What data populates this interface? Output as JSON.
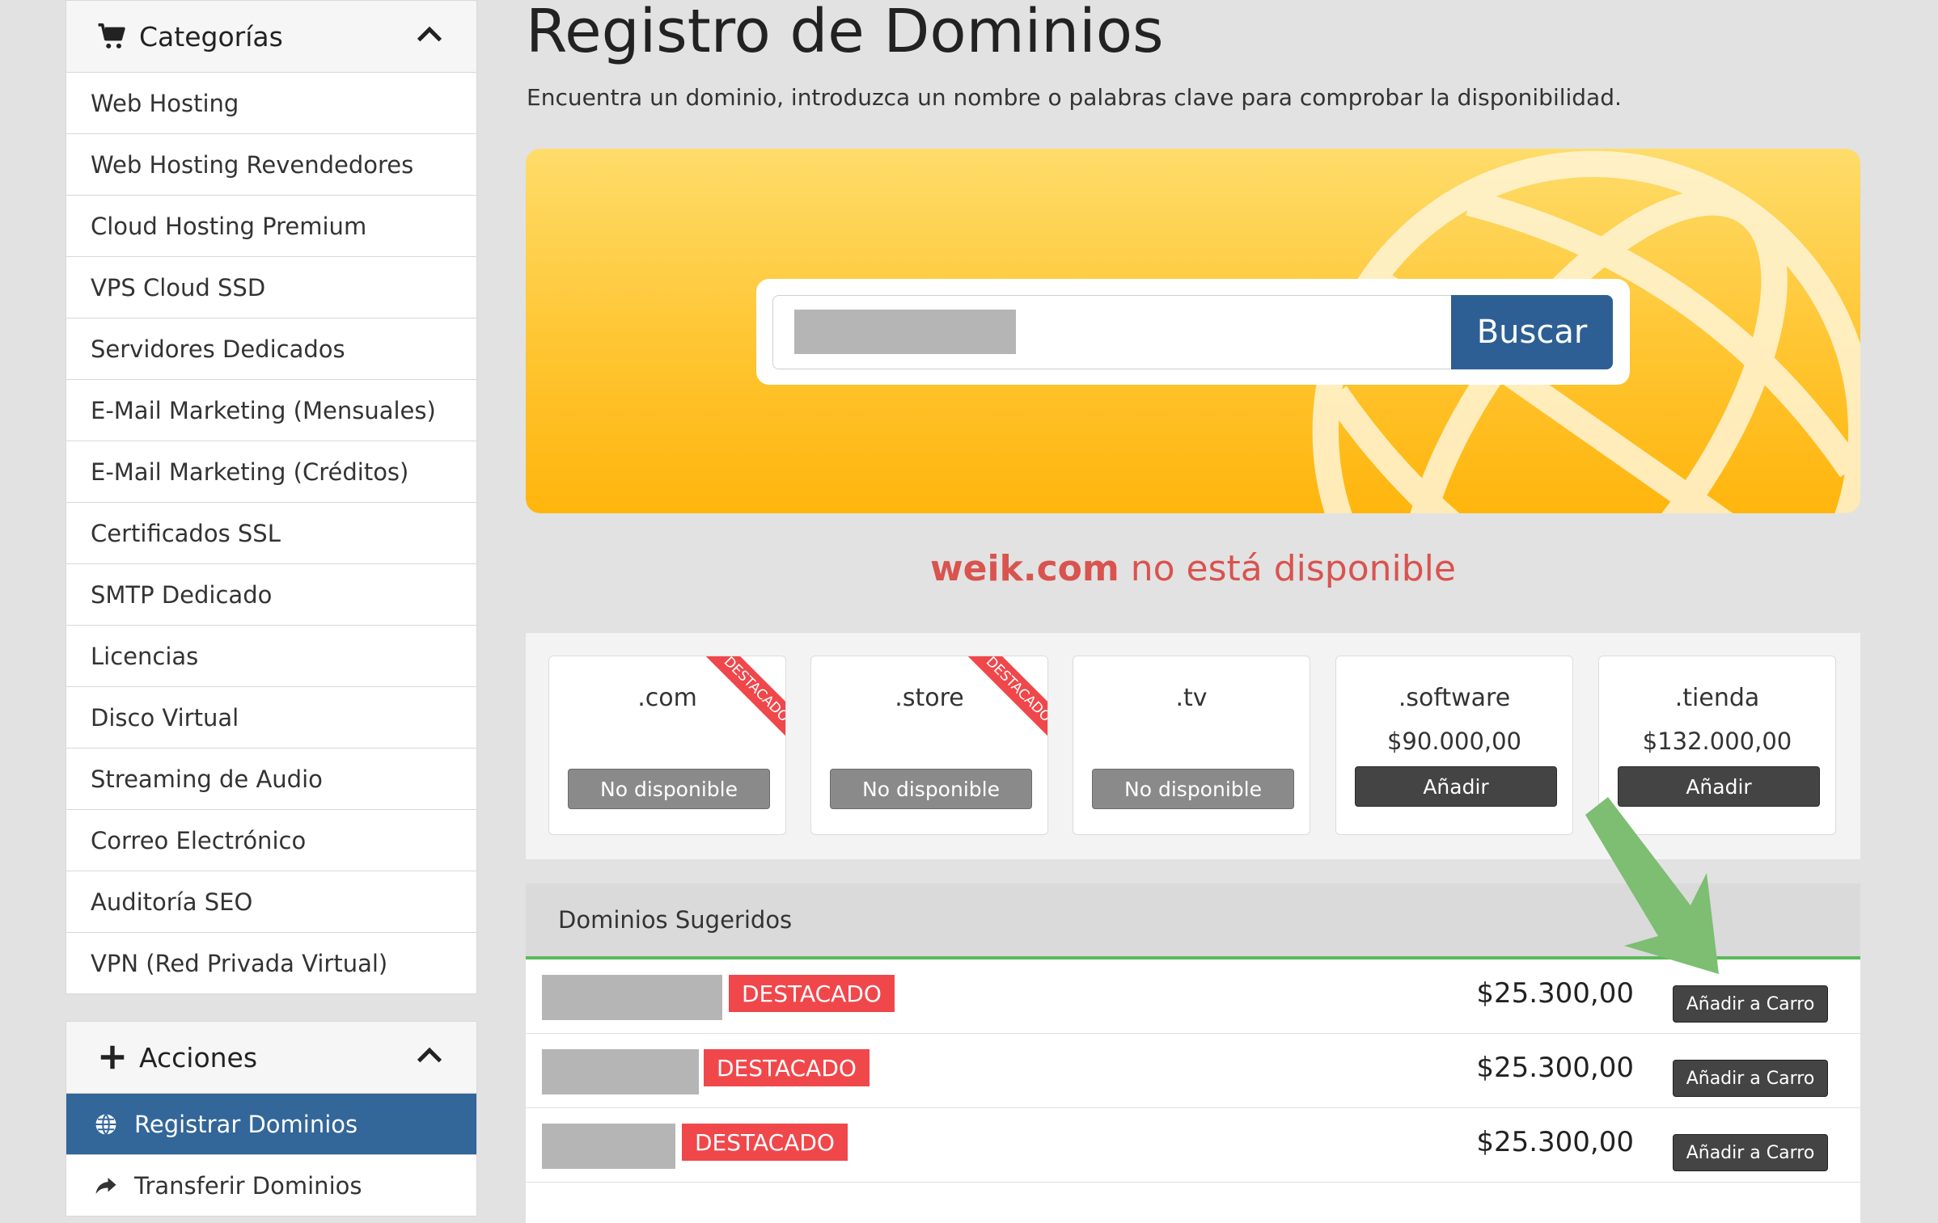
{
  "sidebar": {
    "categories_title": "Categorías",
    "categories": [
      "Web Hosting",
      "Web Hosting Revendedores",
      "Cloud Hosting Premium",
      "VPS Cloud SSD",
      "Servidores Dedicados",
      "E-Mail Marketing (Mensuales)",
      "E-Mail Marketing (Créditos)",
      "Certificados SSL",
      "SMTP Dedicado",
      "Licencias",
      "Disco Virtual",
      "Streaming de Audio",
      "Correo Electrónico",
      "Auditoría SEO",
      "VPN (Red Privada Virtual)"
    ],
    "actions_title": "Acciones",
    "actions": [
      {
        "label": "Registrar Dominios",
        "icon": "globe-icon",
        "active": true
      },
      {
        "label": "Transferir Dominios",
        "icon": "share-arrow-icon",
        "active": false
      }
    ]
  },
  "main": {
    "title": "Registro de Dominios",
    "subtitle": "Encuentra un dominio, introduzca un nombre o palabras clave para comprobar la disponibilidad.",
    "search": {
      "button_label": "Buscar"
    },
    "result": {
      "domain": "weik.com",
      "message": " no está disponible"
    },
    "tlds": [
      {
        "name": ".com",
        "price": "",
        "button": "No disponible",
        "available": false,
        "featured": true,
        "ribbon": "DESTACADO"
      },
      {
        "name": ".store",
        "price": "",
        "button": "No disponible",
        "available": false,
        "featured": true,
        "ribbon": "DESTACADO"
      },
      {
        "name": ".tv",
        "price": "",
        "button": "No disponible",
        "available": false,
        "featured": false,
        "ribbon": ""
      },
      {
        "name": ".software",
        "price": "$90.000,00",
        "button": "Añadir",
        "available": true,
        "featured": false,
        "ribbon": ""
      },
      {
        "name": ".tienda",
        "price": "$132.000,00",
        "button": "Añadir",
        "available": true,
        "featured": false,
        "ribbon": ""
      }
    ],
    "suggested": {
      "title": "Dominios Sugeridos",
      "rows": [
        {
          "badge": "DESTACADO",
          "price": "$25.300,00",
          "button": "Añadir a Carro"
        },
        {
          "badge": "DESTACADO",
          "price": "$25.300,00",
          "button": "Añadir a Carro"
        },
        {
          "badge": "DESTACADO",
          "price": "$25.300,00",
          "button": "Añadir a Carro"
        }
      ]
    }
  },
  "colors": {
    "primary": "#336699",
    "danger": "#d9534f",
    "badge": "#f0474b",
    "accent": "#5cb85c",
    "hero": "#ffc531"
  }
}
